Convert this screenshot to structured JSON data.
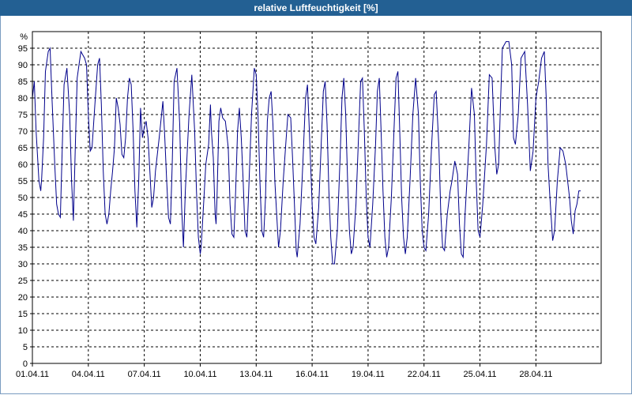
{
  "window": {
    "title": "relative Luftfeuchtigkeit [%]"
  },
  "chart_data": {
    "type": "line",
    "title": "relative Luftfeuchtigkeit [%]",
    "ylabel": "%",
    "xlabel": "",
    "ylim": [
      0,
      100
    ],
    "yticks": [
      "0",
      "5",
      "10",
      "15",
      "20",
      "25",
      "30",
      "35",
      "40",
      "45",
      "50",
      "55",
      "60",
      "65",
      "70",
      "75",
      "80",
      "85",
      "90",
      "95"
    ],
    "xticks": [
      "01.04.11",
      "04.04.11",
      "07.04.11",
      "10.04.11",
      "13.04.11",
      "16.04.11",
      "19.04.11",
      "22.04.11",
      "25.04.11",
      "28.04.11"
    ],
    "xtick_days": [
      0,
      3,
      6,
      9,
      12,
      15,
      18,
      21,
      24,
      27
    ],
    "xlim_days": [
      0,
      30.5
    ],
    "grid": true,
    "line_color": "#00008B",
    "series": [
      {
        "values": [
          [
            0.0,
            80
          ],
          [
            0.1,
            85
          ],
          [
            0.2,
            70
          ],
          [
            0.35,
            55
          ],
          [
            0.45,
            52
          ],
          [
            0.5,
            56
          ],
          [
            0.6,
            68
          ],
          [
            0.7,
            88
          ],
          [
            0.85,
            94
          ],
          [
            0.95,
            95
          ],
          [
            1.05,
            80
          ],
          [
            1.2,
            60
          ],
          [
            1.3,
            48
          ],
          [
            1.4,
            45
          ],
          [
            1.5,
            44
          ],
          [
            1.6,
            65
          ],
          [
            1.7,
            84
          ],
          [
            1.85,
            89
          ],
          [
            2.0,
            75
          ],
          [
            2.1,
            55
          ],
          [
            2.2,
            43
          ],
          [
            2.3,
            65
          ],
          [
            2.4,
            86
          ],
          [
            2.5,
            90
          ],
          [
            2.6,
            94
          ],
          [
            2.7,
            93
          ],
          [
            2.8,
            92
          ],
          [
            2.9,
            90
          ],
          [
            3.0,
            75
          ],
          [
            3.1,
            64
          ],
          [
            3.2,
            65
          ],
          [
            3.35,
            78
          ],
          [
            3.5,
            90
          ],
          [
            3.6,
            92
          ],
          [
            3.7,
            78
          ],
          [
            3.8,
            58
          ],
          [
            3.9,
            45
          ],
          [
            4.0,
            42
          ],
          [
            4.1,
            45
          ],
          [
            4.2,
            52
          ],
          [
            4.3,
            58
          ],
          [
            4.4,
            65
          ],
          [
            4.5,
            80
          ],
          [
            4.6,
            77
          ],
          [
            4.7,
            72
          ],
          [
            4.8,
            63
          ],
          [
            4.9,
            62
          ],
          [
            5.0,
            68
          ],
          [
            5.1,
            80
          ],
          [
            5.2,
            86
          ],
          [
            5.3,
            84
          ],
          [
            5.4,
            70
          ],
          [
            5.5,
            52
          ],
          [
            5.6,
            41
          ],
          [
            5.7,
            55
          ],
          [
            5.8,
            77
          ],
          [
            5.9,
            68
          ],
          [
            6.0,
            71
          ],
          [
            6.1,
            73
          ],
          [
            6.2,
            68
          ],
          [
            6.3,
            58
          ],
          [
            6.4,
            47
          ],
          [
            6.5,
            50
          ],
          [
            6.6,
            58
          ],
          [
            6.8,
            68
          ],
          [
            7.0,
            79
          ],
          [
            7.1,
            68
          ],
          [
            7.2,
            55
          ],
          [
            7.3,
            44
          ],
          [
            7.4,
            42
          ],
          [
            7.5,
            60
          ],
          [
            7.6,
            85
          ],
          [
            7.75,
            89
          ],
          [
            7.9,
            72
          ],
          [
            8.0,
            47
          ],
          [
            8.1,
            35
          ],
          [
            8.2,
            52
          ],
          [
            8.4,
            75
          ],
          [
            8.55,
            87
          ],
          [
            8.7,
            70
          ],
          [
            8.8,
            52
          ],
          [
            8.9,
            38
          ],
          [
            9.0,
            33
          ],
          [
            9.05,
            35
          ],
          [
            9.2,
            50
          ],
          [
            9.3,
            60
          ],
          [
            9.45,
            66
          ],
          [
            9.55,
            78
          ],
          [
            9.6,
            70
          ],
          [
            9.7,
            62
          ],
          [
            9.8,
            45
          ],
          [
            9.85,
            42
          ],
          [
            9.9,
            50
          ],
          [
            10.0,
            73
          ],
          [
            10.1,
            77
          ],
          [
            10.2,
            74
          ],
          [
            10.35,
            73
          ],
          [
            10.5,
            65
          ],
          [
            10.6,
            48
          ],
          [
            10.7,
            39
          ],
          [
            10.8,
            38
          ],
          [
            10.9,
            52
          ],
          [
            11.0,
            70
          ],
          [
            11.1,
            77
          ],
          [
            11.2,
            68
          ],
          [
            11.3,
            55
          ],
          [
            11.4,
            40
          ],
          [
            11.5,
            38
          ],
          [
            11.6,
            52
          ],
          [
            11.75,
            75
          ],
          [
            11.9,
            89
          ],
          [
            12.0,
            87
          ],
          [
            12.1,
            75
          ],
          [
            12.2,
            55
          ],
          [
            12.3,
            40
          ],
          [
            12.4,
            38
          ],
          [
            12.5,
            50
          ],
          [
            12.6,
            73
          ],
          [
            12.7,
            80
          ],
          [
            12.8,
            82
          ],
          [
            12.9,
            72
          ],
          [
            13.0,
            55
          ],
          [
            13.1,
            45
          ],
          [
            13.2,
            35
          ],
          [
            13.3,
            40
          ],
          [
            13.45,
            55
          ],
          [
            13.6,
            67
          ],
          [
            13.7,
            75
          ],
          [
            13.85,
            74
          ],
          [
            13.95,
            62
          ],
          [
            14.05,
            48
          ],
          [
            14.15,
            34
          ],
          [
            14.2,
            32
          ],
          [
            14.35,
            42
          ],
          [
            14.5,
            60
          ],
          [
            14.65,
            80
          ],
          [
            14.75,
            84
          ],
          [
            14.85,
            70
          ],
          [
            15.0,
            48
          ],
          [
            15.1,
            38
          ],
          [
            15.2,
            36
          ],
          [
            15.35,
            47
          ],
          [
            15.5,
            68
          ],
          [
            15.6,
            82
          ],
          [
            15.7,
            85
          ],
          [
            15.8,
            72
          ],
          [
            15.9,
            52
          ],
          [
            16.0,
            38
          ],
          [
            16.1,
            30
          ],
          [
            16.2,
            30
          ],
          [
            16.35,
            40
          ],
          [
            16.5,
            62
          ],
          [
            16.6,
            80
          ],
          [
            16.7,
            86
          ],
          [
            16.8,
            75
          ],
          [
            16.9,
            55
          ],
          [
            17.0,
            40
          ],
          [
            17.1,
            33
          ],
          [
            17.2,
            35
          ],
          [
            17.35,
            48
          ],
          [
            17.5,
            70
          ],
          [
            17.6,
            85
          ],
          [
            17.7,
            86
          ],
          [
            17.8,
            70
          ],
          [
            17.9,
            50
          ],
          [
            18.0,
            38
          ],
          [
            18.1,
            35
          ],
          [
            18.25,
            48
          ],
          [
            18.4,
            66
          ],
          [
            18.5,
            82
          ],
          [
            18.6,
            86
          ],
          [
            18.7,
            70
          ],
          [
            18.8,
            52
          ],
          [
            18.9,
            38
          ],
          [
            19.0,
            32
          ],
          [
            19.1,
            35
          ],
          [
            19.25,
            50
          ],
          [
            19.4,
            72
          ],
          [
            19.5,
            86
          ],
          [
            19.6,
            88
          ],
          [
            19.7,
            70
          ],
          [
            19.8,
            50
          ],
          [
            19.9,
            38
          ],
          [
            20.0,
            33
          ],
          [
            20.1,
            38
          ],
          [
            20.25,
            55
          ],
          [
            20.4,
            75
          ],
          [
            20.55,
            86
          ],
          [
            20.7,
            75
          ],
          [
            20.8,
            55
          ],
          [
            20.9,
            40
          ],
          [
            21.0,
            35
          ],
          [
            21.1,
            34
          ],
          [
            21.25,
            45
          ],
          [
            21.4,
            65
          ],
          [
            21.55,
            81
          ],
          [
            21.65,
            82
          ],
          [
            21.8,
            65
          ],
          [
            21.9,
            45
          ],
          [
            22.0,
            35
          ],
          [
            22.1,
            34
          ],
          [
            22.25,
            45
          ],
          [
            22.4,
            52
          ],
          [
            22.5,
            55
          ],
          [
            22.65,
            61
          ],
          [
            22.8,
            57
          ],
          [
            22.9,
            42
          ],
          [
            23.0,
            33
          ],
          [
            23.1,
            32
          ],
          [
            23.2,
            45
          ],
          [
            23.4,
            65
          ],
          [
            23.55,
            83
          ],
          [
            23.7,
            75
          ],
          [
            23.8,
            55
          ],
          [
            23.9,
            40
          ],
          [
            24.0,
            38
          ],
          [
            24.15,
            48
          ],
          [
            24.35,
            66
          ],
          [
            24.5,
            87
          ],
          [
            24.65,
            86
          ],
          [
            24.8,
            65
          ],
          [
            24.9,
            57
          ],
          [
            25.0,
            60
          ],
          [
            25.1,
            78
          ],
          [
            25.2,
            95
          ],
          [
            25.4,
            97
          ],
          [
            25.55,
            97
          ],
          [
            25.7,
            90
          ],
          [
            25.8,
            68
          ],
          [
            25.9,
            66
          ],
          [
            26.05,
            75
          ],
          [
            26.2,
            92
          ],
          [
            26.4,
            94
          ],
          [
            26.55,
            78
          ],
          [
            26.7,
            58
          ],
          [
            26.85,
            64
          ],
          [
            27.0,
            80
          ],
          [
            27.15,
            85
          ],
          [
            27.3,
            92
          ],
          [
            27.45,
            94
          ],
          [
            27.55,
            80
          ],
          [
            27.65,
            60
          ],
          [
            27.75,
            50
          ],
          [
            27.9,
            37
          ],
          [
            28.0,
            40
          ],
          [
            28.15,
            55
          ],
          [
            28.3,
            65
          ],
          [
            28.45,
            64
          ],
          [
            28.6,
            60
          ],
          [
            28.8,
            50
          ],
          [
            28.9,
            43
          ],
          [
            29.0,
            39
          ],
          [
            29.1,
            46
          ],
          [
            29.2,
            48
          ],
          [
            29.3,
            52
          ],
          [
            29.4,
            52
          ]
        ]
      }
    ]
  }
}
